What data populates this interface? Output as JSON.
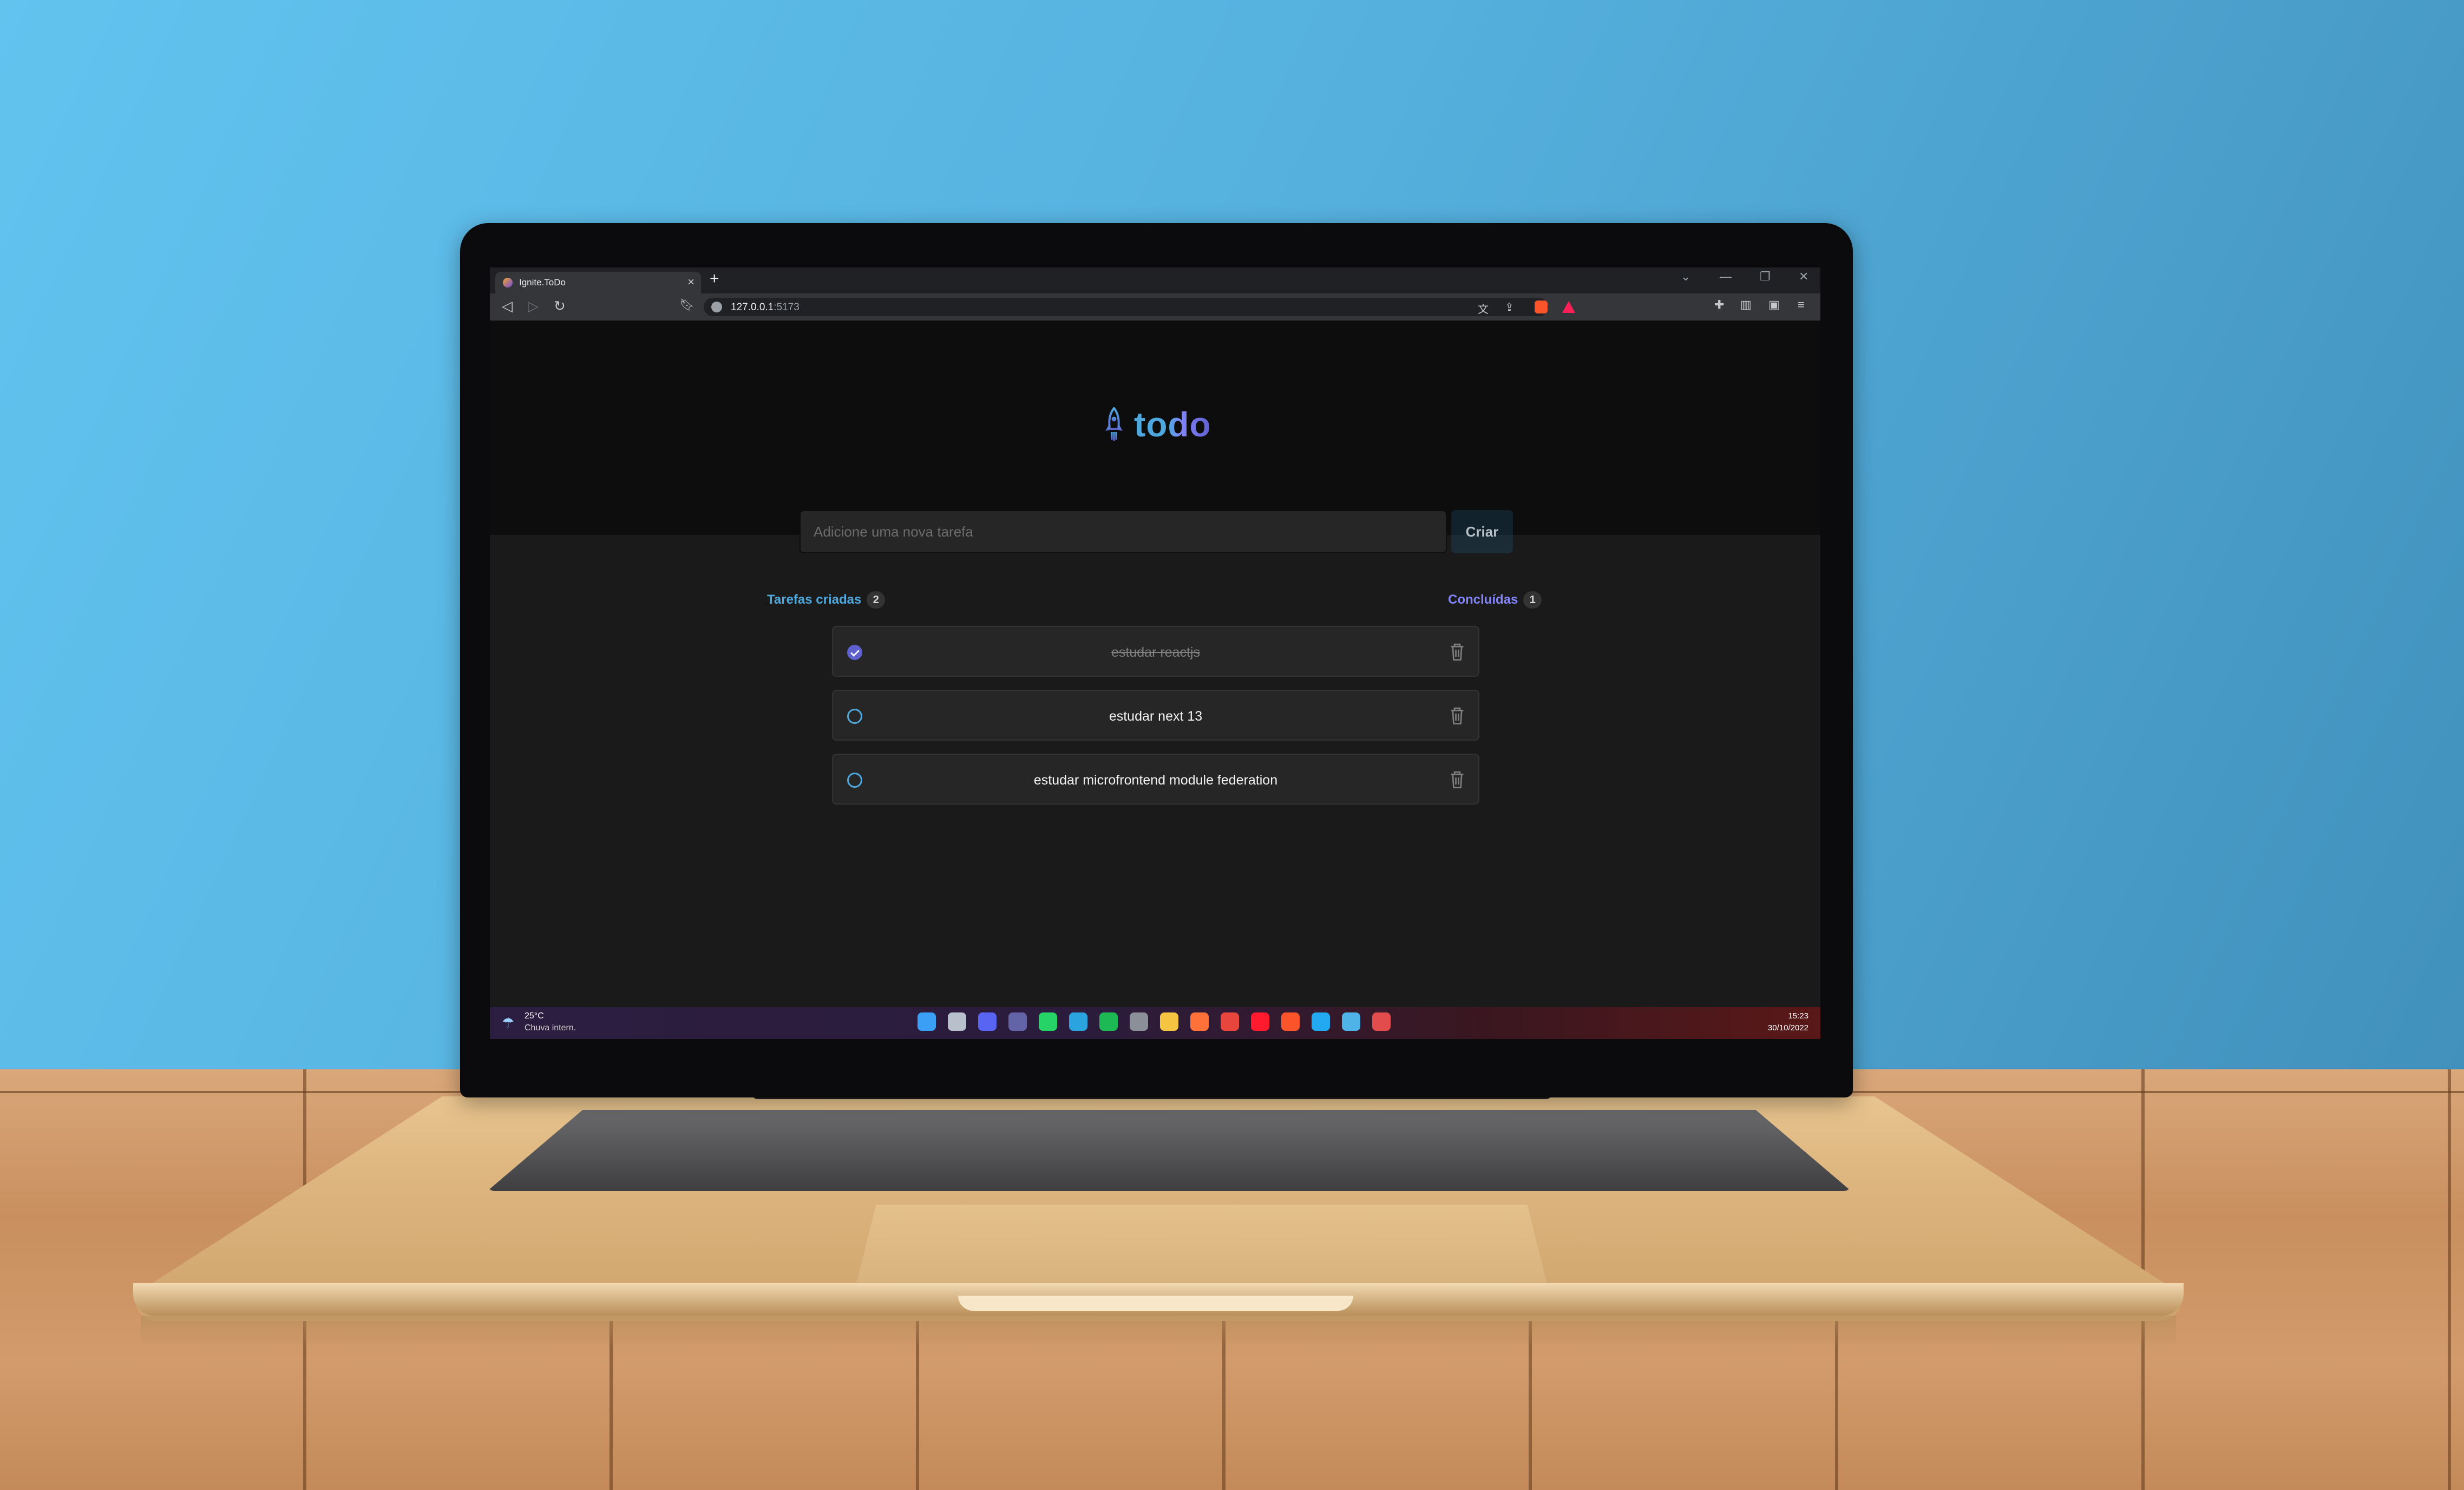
{
  "browser": {
    "tab_title": "Ignite.ToDo",
    "tab_close": "×",
    "new_tab": "+",
    "url_host": "127.0.0.1",
    "url_port": ":5173",
    "window_controls": [
      "⌄",
      "—",
      "❐",
      "✕"
    ]
  },
  "app": {
    "logo_text": "todo",
    "new_task_placeholder": "Adicione uma nova tarefa",
    "create_label": "Criar",
    "created_label": "Tarefas criadas",
    "created_count": "2",
    "done_label": "Concluídas",
    "done_count": "1",
    "tasks": [
      {
        "text": "estudar reactjs",
        "done": true
      },
      {
        "text": "estudar next 13",
        "done": false
      },
      {
        "text": "estudar microfrontend module federation",
        "done": false
      }
    ]
  },
  "taskbar": {
    "weather_temp": "25°C",
    "weather_desc": "Chuva intern.",
    "time": "15:23",
    "date": "30/10/2022",
    "app_icons": [
      {
        "name": "windows-start-icon",
        "color": "#3ba0f5"
      },
      {
        "name": "task-view-icon",
        "color": "#b8c0cc"
      },
      {
        "name": "discord-icon",
        "color": "#5865f2"
      },
      {
        "name": "teams-icon",
        "color": "#6264a7"
      },
      {
        "name": "whatsapp-icon",
        "color": "#25d366"
      },
      {
        "name": "telegram-icon",
        "color": "#2aa3df"
      },
      {
        "name": "spotify-icon",
        "color": "#1db954"
      },
      {
        "name": "calculator-icon",
        "color": "#8a8f98"
      },
      {
        "name": "file-explorer-icon",
        "color": "#f5c542"
      },
      {
        "name": "firefox-icon",
        "color": "#ff7139"
      },
      {
        "name": "chrome-icon",
        "color": "#e8453c"
      },
      {
        "name": "opera-icon",
        "color": "#ff1b2d"
      },
      {
        "name": "brave-icon",
        "color": "#fb542b"
      },
      {
        "name": "vscode-icon",
        "color": "#23a9f2"
      },
      {
        "name": "globe-app-icon",
        "color": "#4fb3e8"
      },
      {
        "name": "paint-app-icon",
        "color": "#e34c4c"
      }
    ]
  },
  "colors": {
    "blue": "#4ea8de",
    "purple": "#8284fa",
    "purple_dark": "#5e60ce",
    "page_bg": "#1a1a1a",
    "header_bg": "#0d0d0d"
  }
}
